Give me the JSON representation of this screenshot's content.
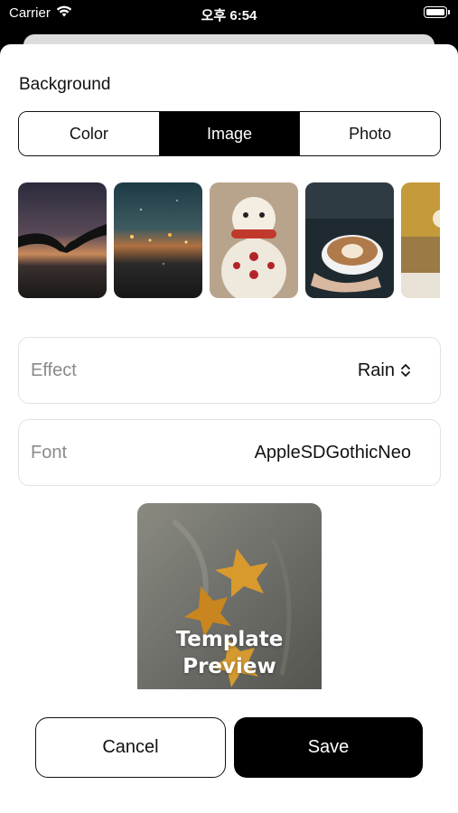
{
  "status_bar": {
    "carrier": "Carrier",
    "time": "오후 6:54"
  },
  "sheet": {
    "background_label": "Background",
    "segments": [
      {
        "label": "Color",
        "selected": false
      },
      {
        "label": "Image",
        "selected": true
      },
      {
        "label": "Photo",
        "selected": false
      }
    ],
    "thumbnails": [
      {
        "name": "sunset-holding-hands"
      },
      {
        "name": "rain-window-lights"
      },
      {
        "name": "snowman-toy"
      },
      {
        "name": "latte-art-coffee"
      },
      {
        "name": "yellow-cozy-room"
      }
    ],
    "effect": {
      "label": "Effect",
      "value": "Rain"
    },
    "font": {
      "label": "Font",
      "value": "AppleSDGothicNeo"
    },
    "preview": {
      "line1": "Template",
      "line2": "Preview"
    },
    "buttons": {
      "cancel": "Cancel",
      "save": "Save"
    }
  },
  "colors": {
    "accent": "#000000",
    "background": "#ffffff",
    "muted_text": "#8a8a8a"
  }
}
